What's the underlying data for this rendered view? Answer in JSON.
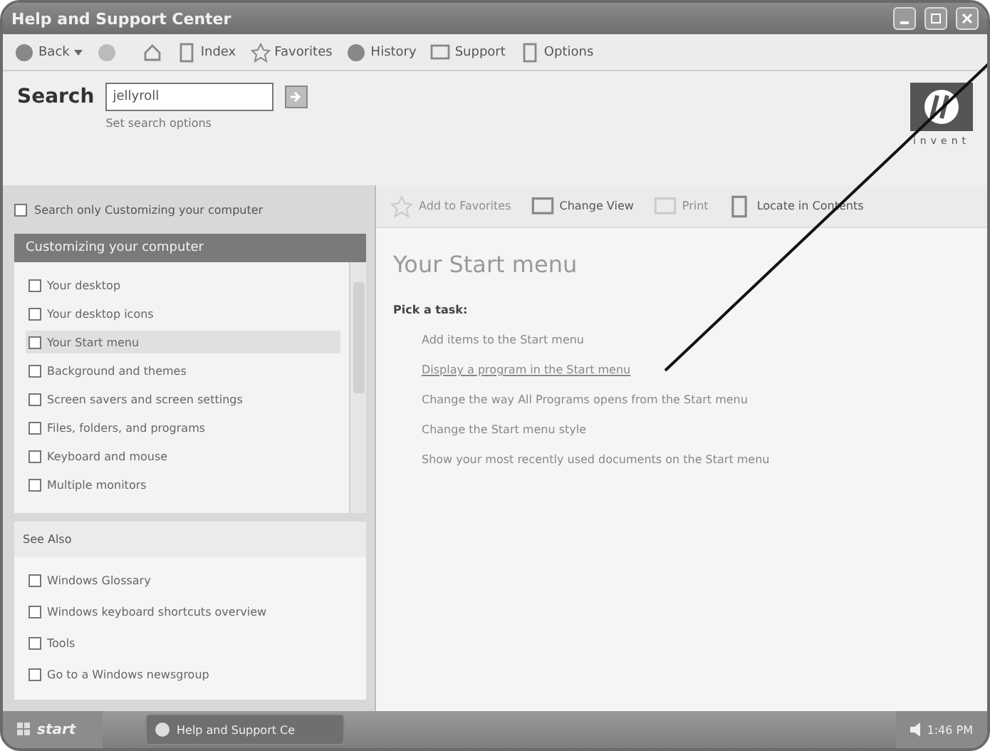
{
  "window": {
    "title": "Help and Support Center"
  },
  "toolbar": {
    "back": {
      "label": "Back"
    },
    "items": [
      {
        "label": "Index"
      },
      {
        "label": "Favorites"
      },
      {
        "label": "History"
      },
      {
        "label": "Support"
      },
      {
        "label": "Options"
      }
    ]
  },
  "search": {
    "label": "Search",
    "value": "jellyroll",
    "options_link": "Set search options"
  },
  "logo": {
    "tagline": "invent"
  },
  "left_pane": {
    "search_only": {
      "label": "Search only Customizing your computer",
      "checked": false
    },
    "topic": {
      "title": "Customizing your computer",
      "items": [
        {
          "label": "Your desktop",
          "selected": false
        },
        {
          "label": "Your desktop icons",
          "selected": false
        },
        {
          "label": "Your Start menu",
          "selected": true
        },
        {
          "label": "Background and themes",
          "selected": false
        },
        {
          "label": "Screen savers and screen settings",
          "selected": false
        },
        {
          "label": "Files, folders, and programs",
          "selected": false
        },
        {
          "label": "Keyboard and mouse",
          "selected": false
        },
        {
          "label": "Multiple monitors",
          "selected": false
        }
      ]
    },
    "see_also": {
      "title": "See Also",
      "items": [
        {
          "label": "Windows Glossary"
        },
        {
          "label": "Windows keyboard shortcuts overview"
        },
        {
          "label": "Tools"
        },
        {
          "label": "Go to a Windows newsgroup"
        }
      ]
    }
  },
  "content": {
    "toolbar": [
      {
        "label": "Add to Favorites",
        "disabled": true
      },
      {
        "label": "Change View",
        "disabled": false
      },
      {
        "label": "Print",
        "disabled": true
      },
      {
        "label": "Locate in Contents",
        "disabled": false
      }
    ],
    "title": "Your Start menu",
    "subtitle": "Pick a task:",
    "tasks": [
      {
        "label": "Add items to the Start menu",
        "hovered": false
      },
      {
        "label": "Display a program in the Start menu",
        "hovered": true
      },
      {
        "label": "Change the way All Programs opens from the Start menu",
        "hovered": false
      },
      {
        "label": "Change the Start menu style",
        "hovered": false
      },
      {
        "label": "Show your most recently used documents on the Start menu",
        "hovered": false
      }
    ]
  },
  "taskbar": {
    "start": "start",
    "tasks": [
      {
        "label": "Help and Support Ce",
        "selected": true
      }
    ],
    "clock": "1:46 PM"
  }
}
